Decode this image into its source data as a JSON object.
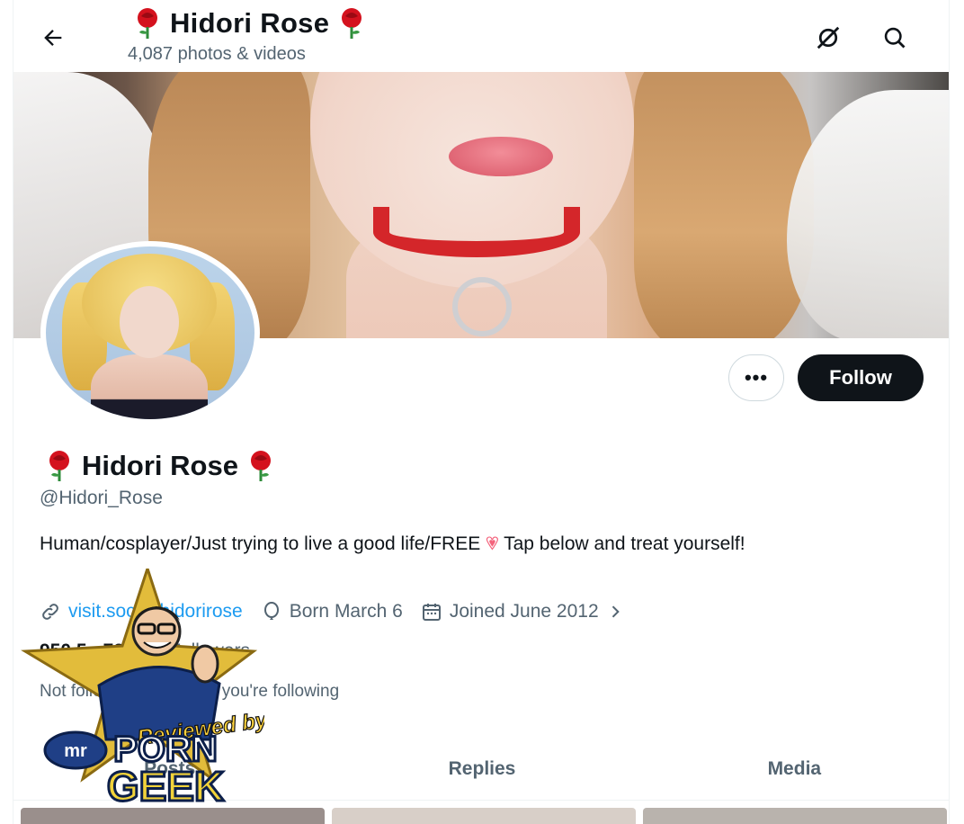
{
  "header": {
    "title": "Hidori Rose",
    "subtitle": "4,087 photos & videos"
  },
  "profile": {
    "name": "Hidori Rose",
    "handle": "@Hidori_Rose",
    "bio_before_heart": "Human/cosplayer/Just trying to live a good life/FREE",
    "bio_after_heart": "Tap below and treat yourself!",
    "link": "visit.social/hidorirose",
    "born": "Born March 6",
    "joined": "Joined June 2012",
    "following_count": "950.5",
    "followers_count": "729.5K",
    "followers_label": "Followers",
    "mutual": "Not followed by anyone you're following"
  },
  "actions": {
    "more_label": "•••",
    "follow_label": "Follow"
  },
  "tabs": [
    {
      "label": "Posts"
    },
    {
      "label": "Replies"
    },
    {
      "label": "Media"
    }
  ],
  "watermark": {
    "line1": "Reviewed by",
    "line2": "mr",
    "line3": "PORN",
    "line4": "GEEK"
  },
  "colors": {
    "accent": "#1d9bf0",
    "follow_bg": "#0f1419",
    "muted": "#536471",
    "rose": "#d4121e"
  },
  "icons": [
    "back-arrow-icon",
    "grok-icon",
    "search-icon",
    "rose-icon",
    "link-icon",
    "balloon-icon",
    "calendar-icon",
    "chevron-right-icon"
  ]
}
